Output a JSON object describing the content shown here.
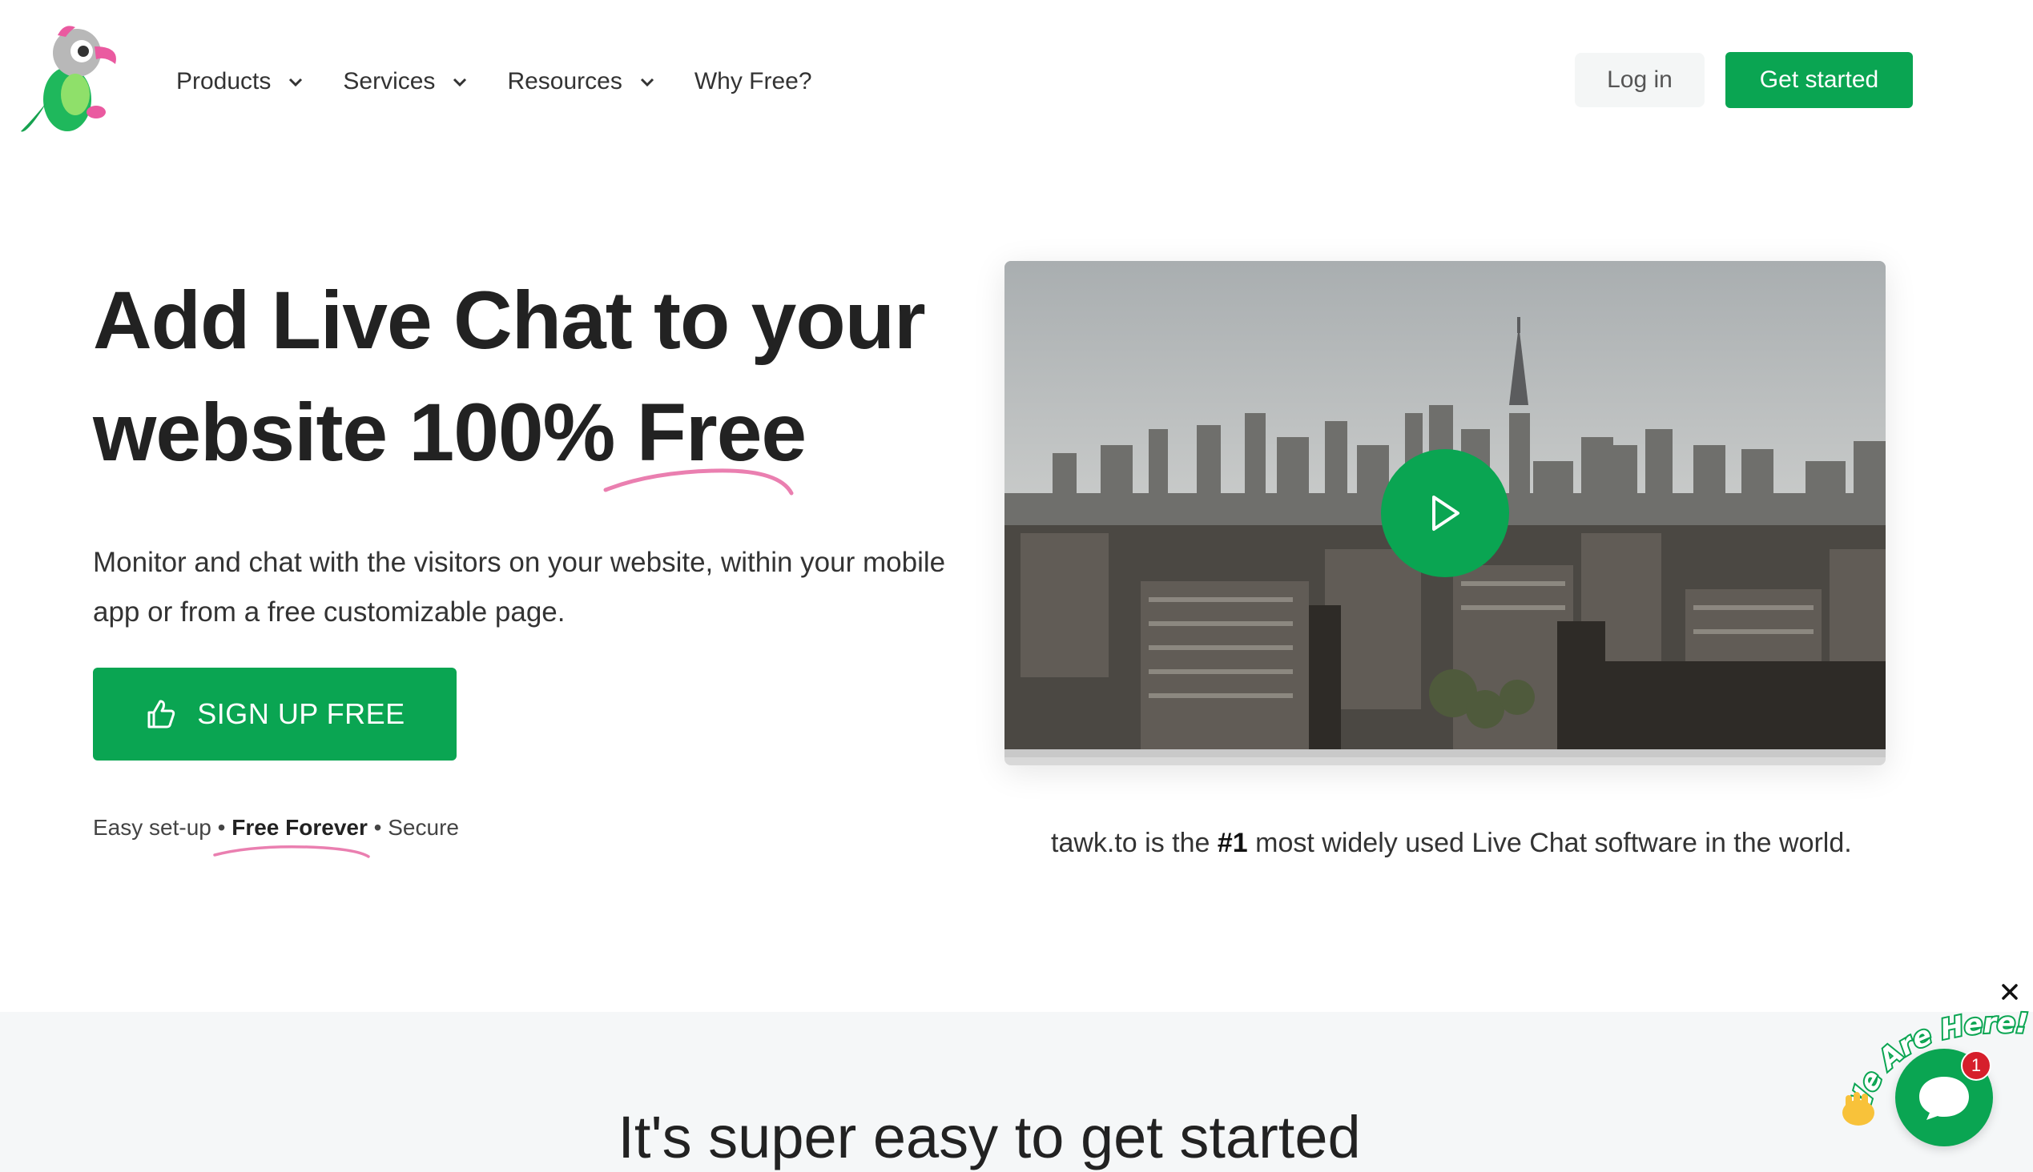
{
  "nav": {
    "items": [
      {
        "label": "Products",
        "has_dropdown": true
      },
      {
        "label": "Services",
        "has_dropdown": true
      },
      {
        "label": "Resources",
        "has_dropdown": true
      },
      {
        "label": "Why Free?",
        "has_dropdown": false
      }
    ],
    "login_label": "Log in",
    "get_started_label": "Get started"
  },
  "hero": {
    "title_line1": "Add Live Chat to your",
    "title_line2": "website 100% Free",
    "description": "Monitor and chat with the visitors on your website, within your mobile app or from a free customizable page.",
    "signup_label": "SIGN UP FREE",
    "features": {
      "item1": "Easy set-up",
      "sep": "•",
      "item2": "Free Forever",
      "item3": "Secure"
    }
  },
  "video": {
    "caption_prefix": "tawk.to is the ",
    "caption_highlight": "#1",
    "caption_suffix": " most widely used Live Chat software in the world."
  },
  "section2": {
    "title": "It's super easy to get started"
  },
  "widget": {
    "label": "We Are Here!",
    "badge_count": "1"
  },
  "colors": {
    "brand_green": "#0aa552",
    "accent_pink": "#ea7fb0",
    "badge_red": "#d61f2c"
  },
  "icons": [
    "parrot-logo",
    "chevron-down-icon",
    "thumbs-up-icon",
    "play-icon",
    "close-icon",
    "chat-icon",
    "waving-hand-icon"
  ]
}
